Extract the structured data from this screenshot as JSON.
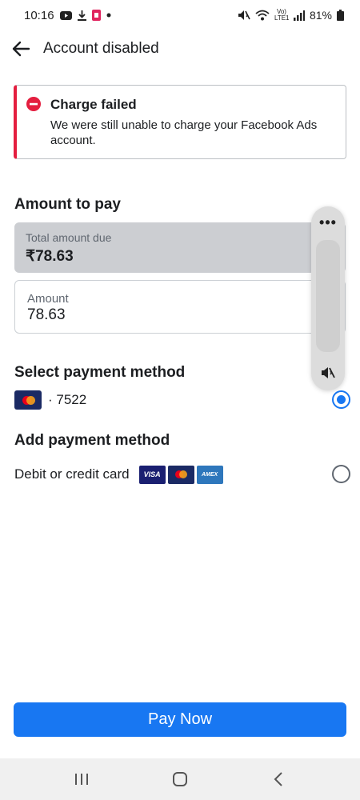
{
  "status_bar": {
    "time": "10:16",
    "signal_text": "Vo) LTE1",
    "battery": "81%"
  },
  "header": {
    "title": "Account disabled",
    "back_icon": "arrow-left-icon"
  },
  "alert": {
    "title": "Charge failed",
    "message": "We were still unable to charge your Facebook Ads account.",
    "icon": "minus-circle-icon",
    "accent_color": "#e41e3f"
  },
  "amount_section": {
    "heading": "Amount to pay",
    "total_due_label": "Total amount due",
    "total_due_value": "₹78.63",
    "amount_label": "Amount",
    "amount_value": "78.63"
  },
  "select_method": {
    "heading": "Select payment method",
    "card_suffix": "· 7522",
    "selected": true
  },
  "add_method": {
    "heading": "Add payment method",
    "option_label": "Debit or credit card",
    "logos": [
      "VISA",
      "mastercard",
      "AMEX"
    ],
    "selected": false
  },
  "footer": {
    "pay_label": "Pay Now",
    "accent_color": "#1877f2"
  }
}
